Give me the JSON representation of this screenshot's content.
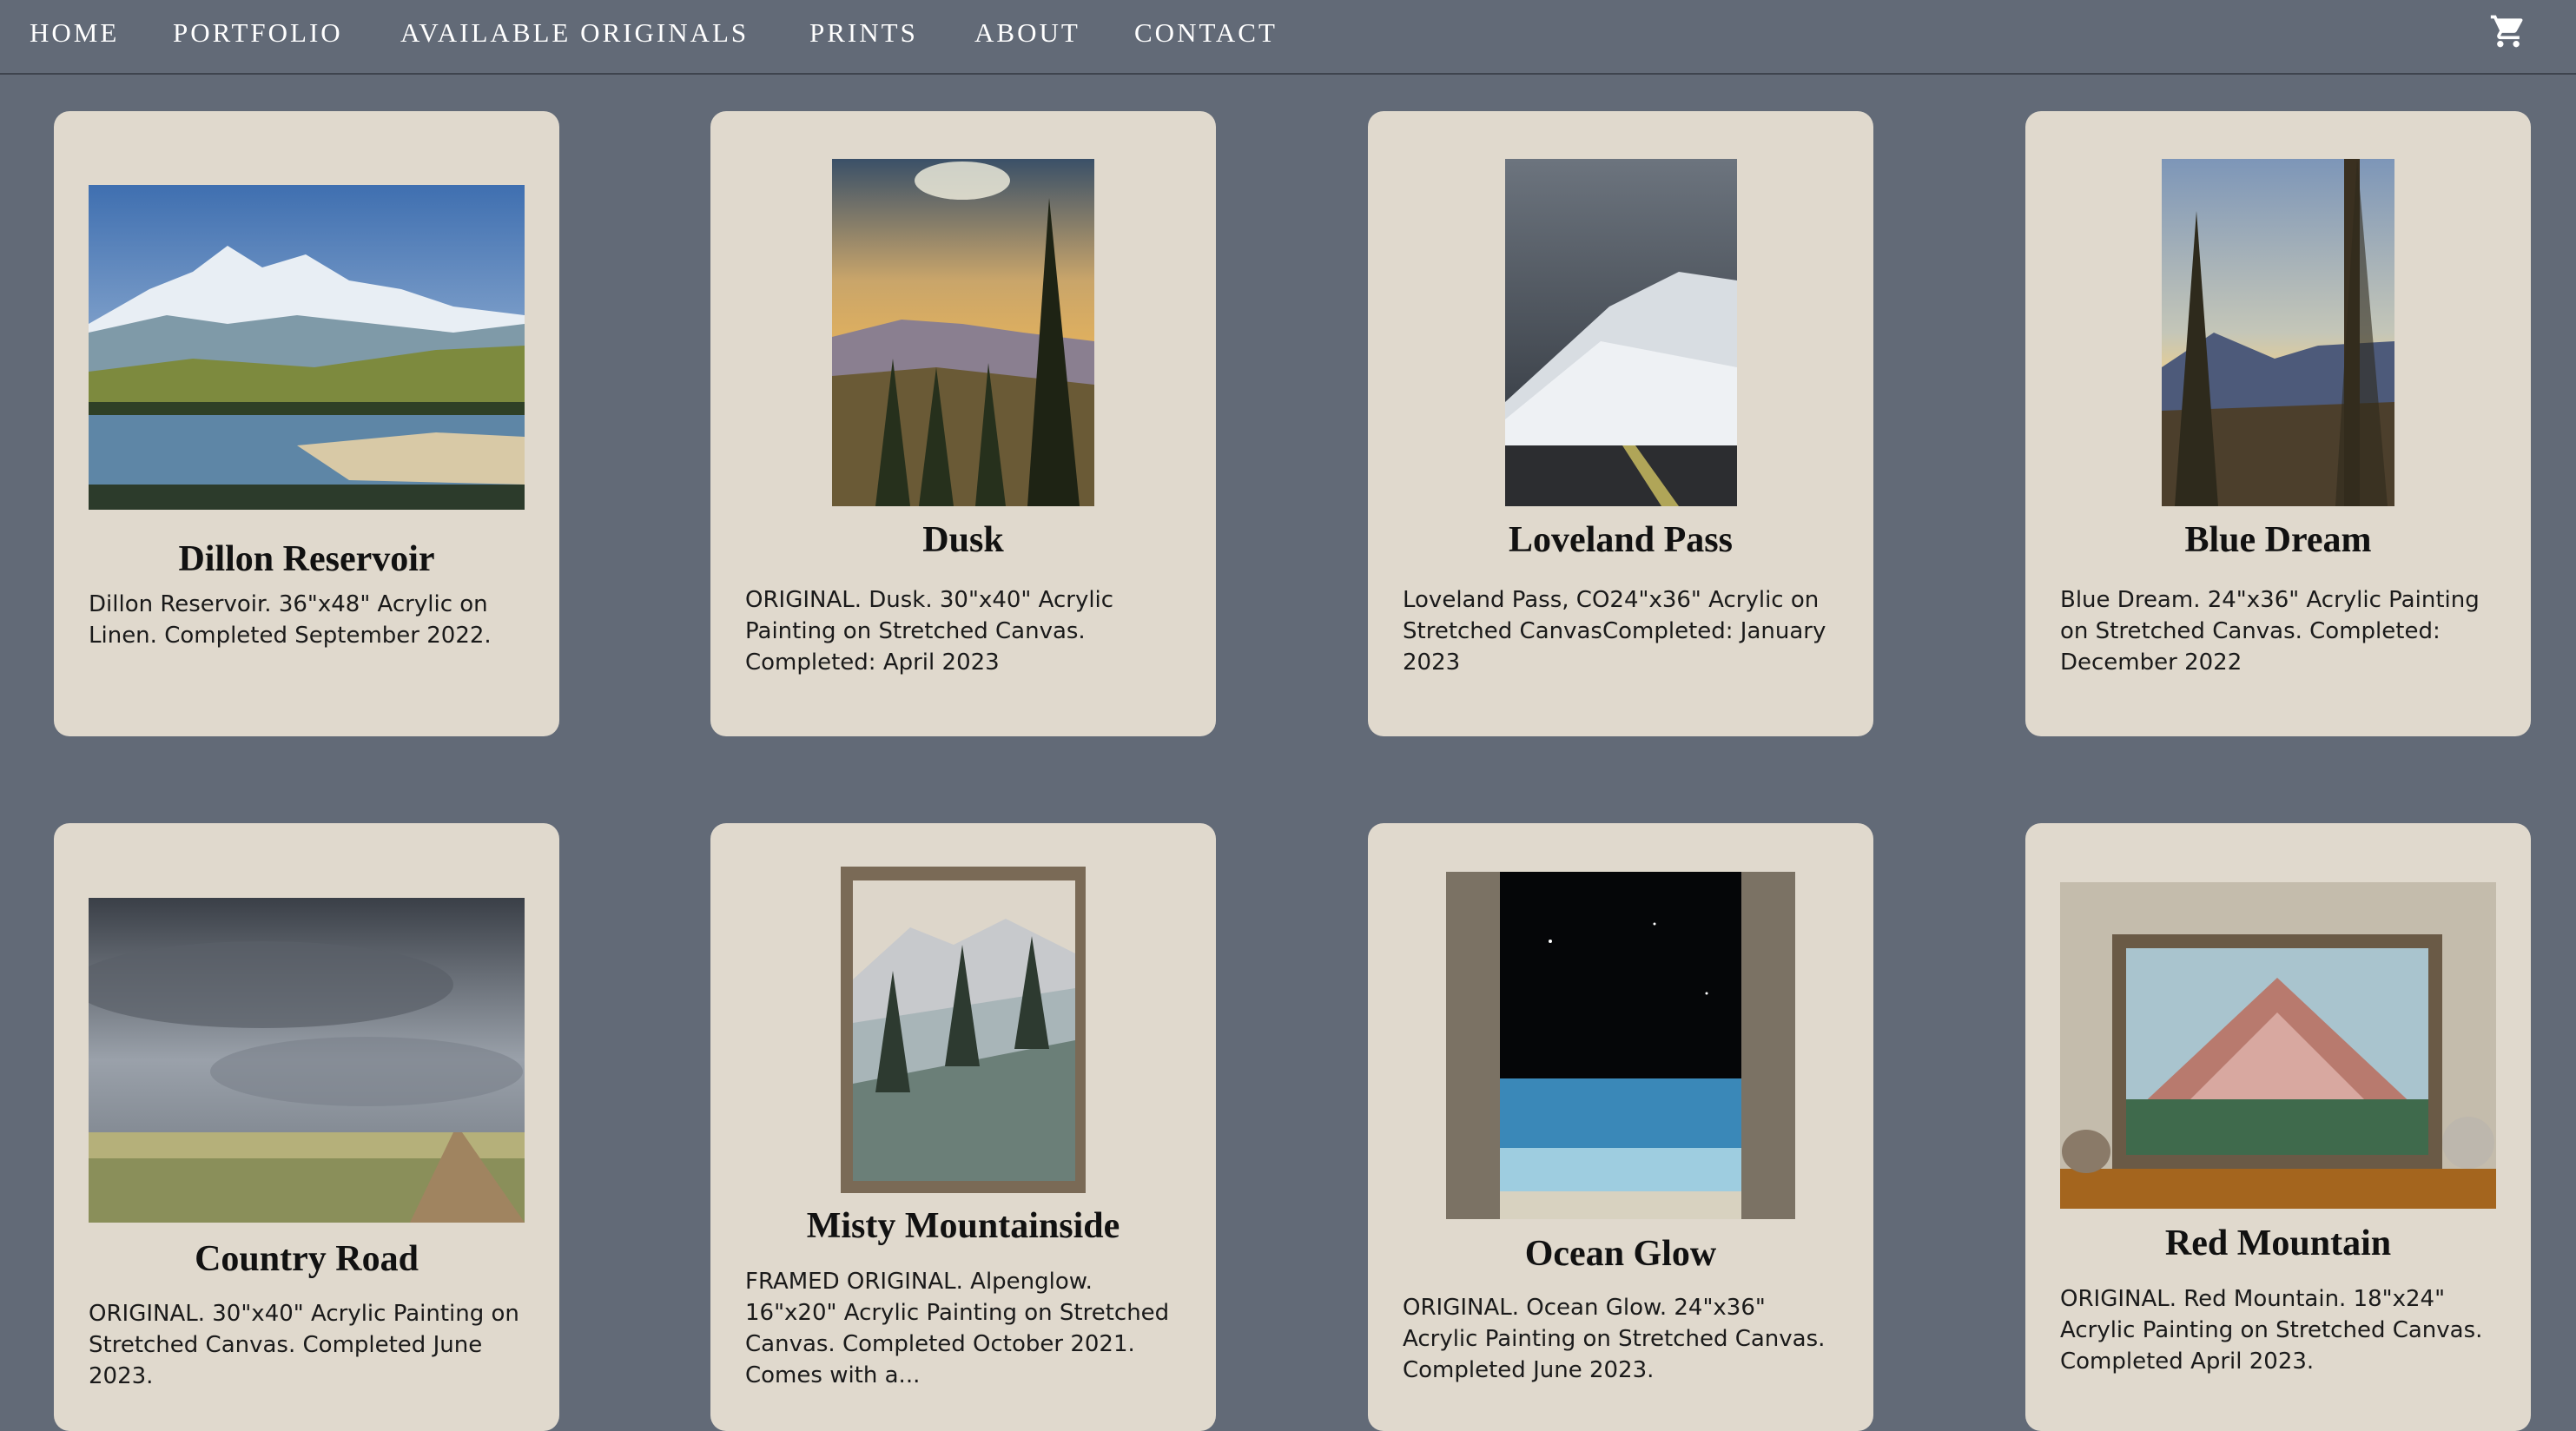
{
  "nav": {
    "items": [
      "HOME",
      "PORTFOLIO",
      "AVAILABLE ORIGINALS",
      "PRINTS",
      "ABOUT",
      "CONTACT"
    ],
    "cart_icon": "shopping-cart-icon"
  },
  "colors": {
    "page_bg": "#626a77",
    "card_bg": "#e0d9cd",
    "nav_text": "#ffffff",
    "title_text": "#111111"
  },
  "cards": [
    {
      "title": "Dillon Reservoir",
      "description": "Dillon Reservoir. 36\"x48\" Acrylic on Linen. Completed September 2022."
    },
    {
      "title": "Dusk",
      "description": "ORIGINAL. Dusk. 30\"x40\" Acrylic Painting on Stretched Canvas. Completed: April 2023"
    },
    {
      "title": "Loveland Pass",
      "description": "Loveland Pass, CO24\"x36\" Acrylic on Stretched CanvasCompleted: January 2023"
    },
    {
      "title": "Blue Dream",
      "description": "Blue Dream. 24\"x36\" Acrylic Painting on Stretched Canvas. Completed: December 2022"
    },
    {
      "title": "Country Road",
      "description": "ORIGINAL. 30\"x40\" Acrylic Painting on Stretched Canvas. Completed June 2023."
    },
    {
      "title": "Misty Mountainside",
      "description": "FRAMED ORIGINAL. Alpenglow. 16\"x20\" Acrylic Painting on Stretched Canvas. Completed October 2021. Comes with a..."
    },
    {
      "title": "Ocean Glow",
      "description": "ORIGINAL. Ocean Glow. 24\"x36\" Acrylic Painting on Stretched Canvas. Completed June 2023."
    },
    {
      "title": "Red Mountain",
      "description": "ORIGINAL. Red Mountain. 18\"x24\" Acrylic Painting on Stretched Canvas. Completed April 2023."
    }
  ]
}
